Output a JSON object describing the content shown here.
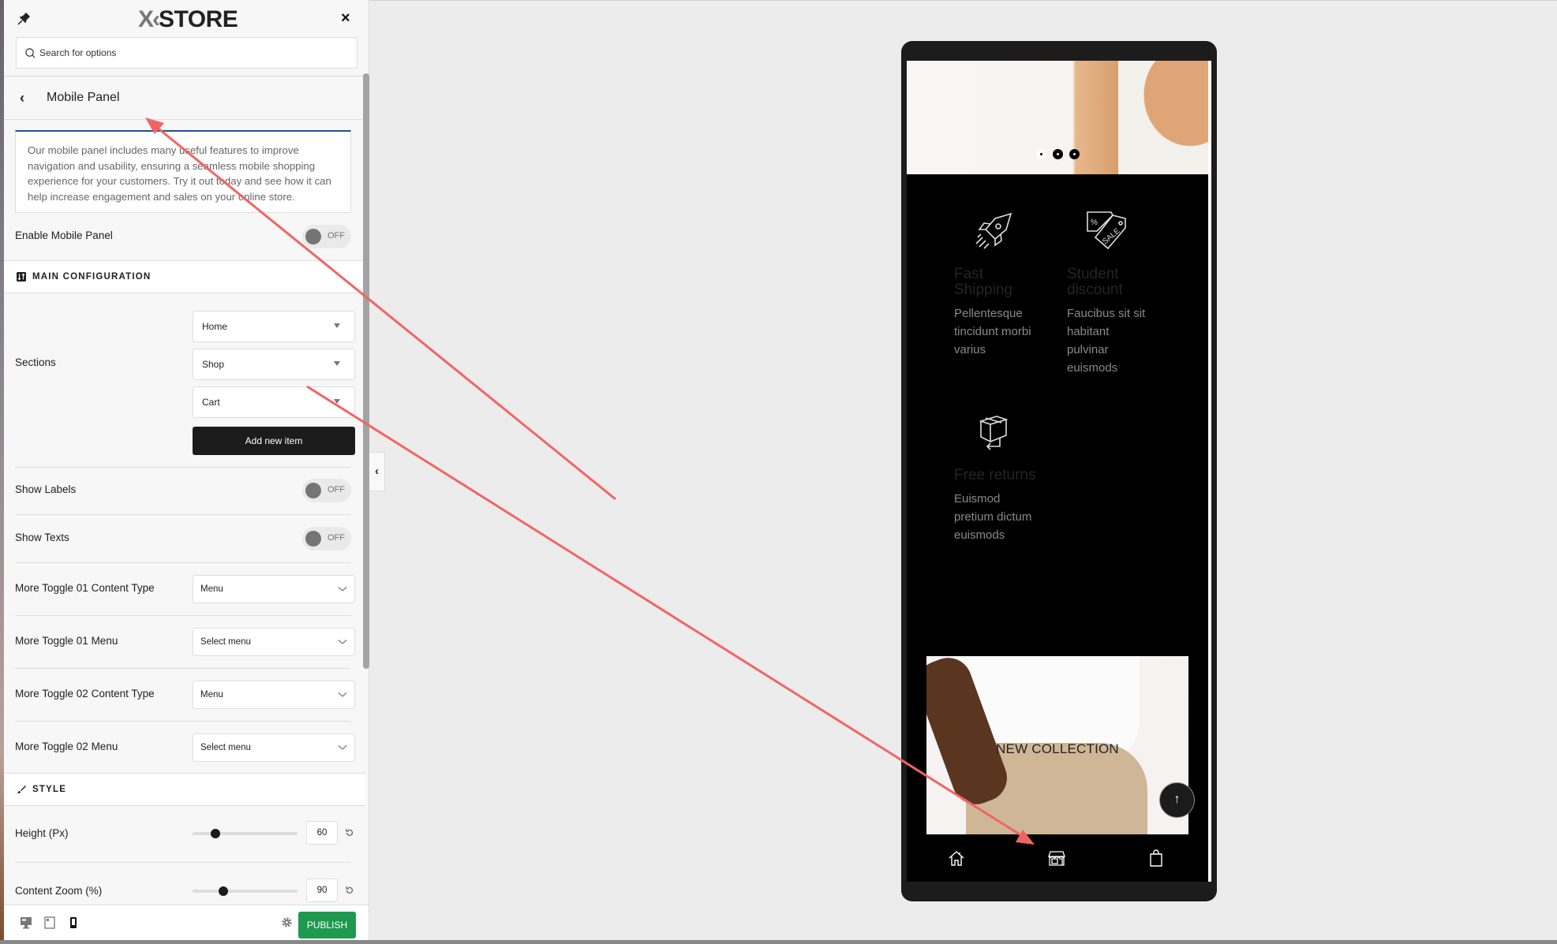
{
  "customizer": {
    "logo_prefix": "X",
    "logo_text": "STORE",
    "close_label": "×",
    "search_placeholder": "Search for options",
    "back_label": "‹",
    "section_title": "Mobile Panel",
    "description": "Our mobile panel includes many useful features to improve navigation and usability, ensuring a seamless mobile shopping experience for your customers. Try it out today and see how it can help increase engagement and sales on your online store.",
    "enable": {
      "label": "Enable Mobile Panel",
      "state": "OFF"
    },
    "main_config": {
      "heading": "MAIN CONFIGURATION",
      "sections_label": "Sections",
      "sections": [
        "Home",
        "Shop",
        "Cart"
      ],
      "add_button": "Add new item",
      "show_labels": {
        "label": "Show Labels",
        "state": "OFF"
      },
      "show_texts": {
        "label": "Show Texts",
        "state": "OFF"
      },
      "selects": [
        {
          "label": "More Toggle 01 Content Type",
          "value": "Menu"
        },
        {
          "label": "More Toggle 01 Menu",
          "value": "Select menu"
        },
        {
          "label": "More Toggle 02 Content Type",
          "value": "Menu"
        },
        {
          "label": "More Toggle 02 Menu",
          "value": "Select menu"
        }
      ]
    },
    "style": {
      "heading": "STYLE",
      "sliders": [
        {
          "label": "Height (Px)",
          "value": "60",
          "fill": 0.22
        },
        {
          "label": "Content Zoom (%)",
          "value": "90",
          "fill": 0.29
        }
      ]
    },
    "footer": {
      "devices": [
        "desktop-icon",
        "tablet-icon",
        "mobile-icon"
      ],
      "active_device": "mobile",
      "publish_label": "PUBLISH",
      "publish_color": "#1d9a4e"
    },
    "collapse_label": "‹"
  },
  "preview": {
    "slider_dots": {
      "count": 3,
      "active": 0
    },
    "features": [
      {
        "icon": "rocket-icon",
        "title": "Fast Shipping",
        "text": "Pellentesque tincidunt morbi varius"
      },
      {
        "icon": "sale-tag-icon",
        "title": "Student discount",
        "text": "Faucibus sit sit habitant pulvinar euismods"
      },
      {
        "icon": "box-return-icon",
        "title": "Free returns",
        "text": "Euismod pretium dictum euismods"
      }
    ],
    "collection_title": "NEW COLLECTION",
    "back_to_top": "↑",
    "mobile_panel_items": [
      "home-icon",
      "shop-icon",
      "cart-bag-icon"
    ]
  },
  "annotation": {
    "arrow_color": "#f26464"
  }
}
